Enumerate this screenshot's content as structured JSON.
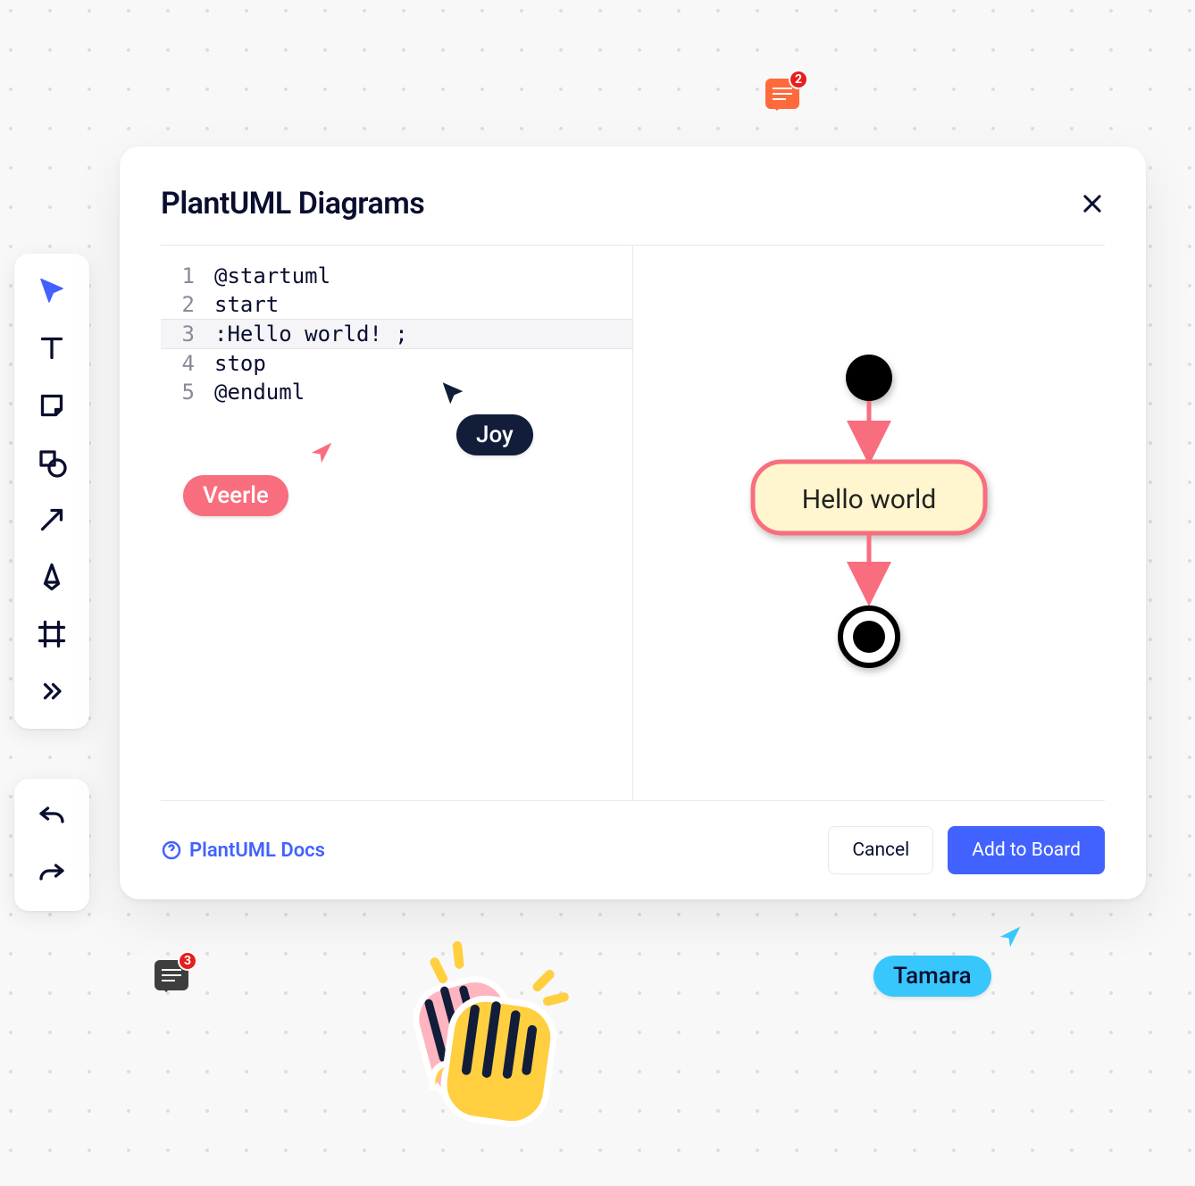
{
  "modal": {
    "title": "PlantUML Diagrams",
    "docs_text": "PlantUML Docs",
    "cancel": "Cancel",
    "add": "Add to Board",
    "code": {
      "active_line": 3,
      "lines": [
        {
          "n": "1",
          "t": "@startuml"
        },
        {
          "n": "2",
          "t": "start"
        },
        {
          "n": "3",
          "t": ":Hello world! ;"
        },
        {
          "n": "4",
          "t": "stop"
        },
        {
          "n": "5",
          "t": "@enduml"
        }
      ]
    },
    "preview": {
      "node_label": "Hello world"
    }
  },
  "cursors": {
    "veerle": {
      "label": "Veerle",
      "color": "#f86e7e"
    },
    "joy": {
      "label": "Joy",
      "color": "#121d3a"
    },
    "tamara": {
      "label": "Tamara",
      "color": "#37c7fc"
    }
  },
  "bubbles": {
    "top": {
      "count": "2"
    },
    "left": {
      "count": "3"
    }
  }
}
